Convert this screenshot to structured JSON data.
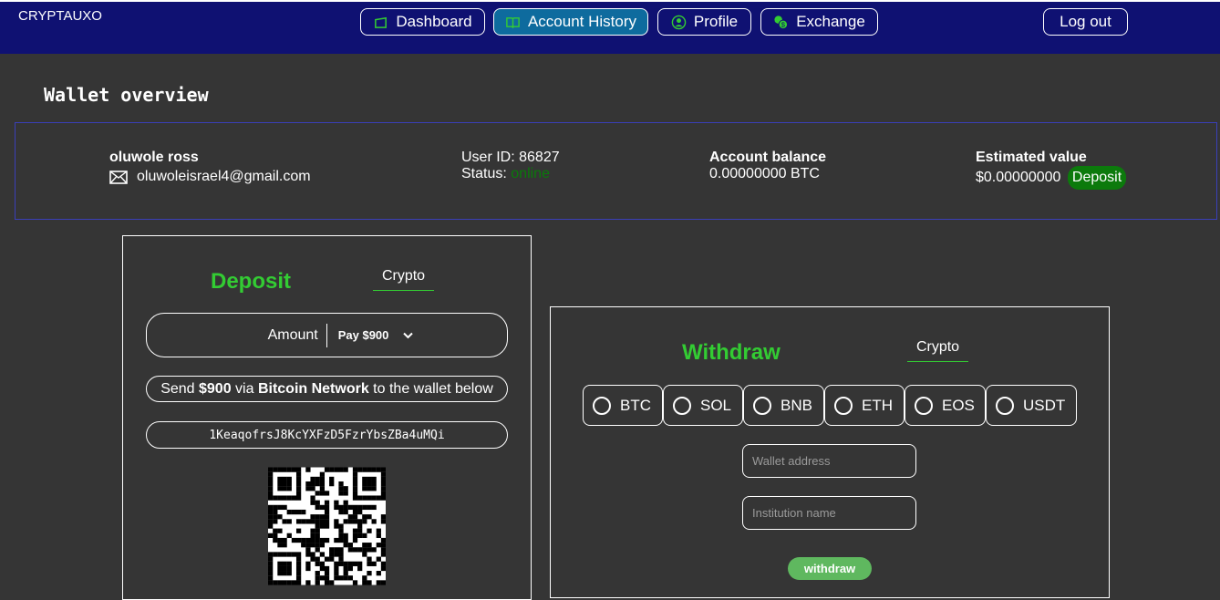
{
  "app": {
    "brand": "CRYPTAUXO"
  },
  "nav": {
    "dashboard": "Dashboard",
    "account_history": "Account History",
    "profile": "Profile",
    "exchange": "Exchange",
    "logout": "Log out",
    "active": "account_history"
  },
  "page": {
    "title": "Wallet overview"
  },
  "overview": {
    "name": "oluwole ross",
    "email": "oluwoleisrael4@gmail.com",
    "user_id": "User ID: 86827",
    "status_label": "Status:",
    "status_value": "online",
    "balance_label": "Account balance",
    "balance_value": "0.00000000 BTC",
    "estimated_label": "Estimated value",
    "estimated_value": "$0.00000000",
    "deposit_badge": "Deposit"
  },
  "deposit": {
    "title": "Deposit",
    "tab": "Crypto",
    "amount_label": "Amount",
    "amount_selected": "Pay $900",
    "send_prefix": "Send ",
    "send_amount": "$900",
    "send_via": " via ",
    "send_network": "Bitcoin Network",
    "send_suffix": " to the wallet below",
    "wallet_address": "1KeaqofrsJ8KcYXFzD5FzrYbsZBa4uMQi"
  },
  "withdraw": {
    "title": "Withdraw",
    "tab": "Crypto",
    "coins": [
      "BTC",
      "SOL",
      "BNB",
      "ETH",
      "EOS",
      "USDT"
    ],
    "wallet_placeholder": "Wallet address",
    "institution_placeholder": "Institution name",
    "button": "withdraw"
  },
  "colors": {
    "topbar": "#0f1172",
    "active_tab": "#0e6b9e",
    "accent_green": "#33cc33",
    "background": "#353535"
  }
}
